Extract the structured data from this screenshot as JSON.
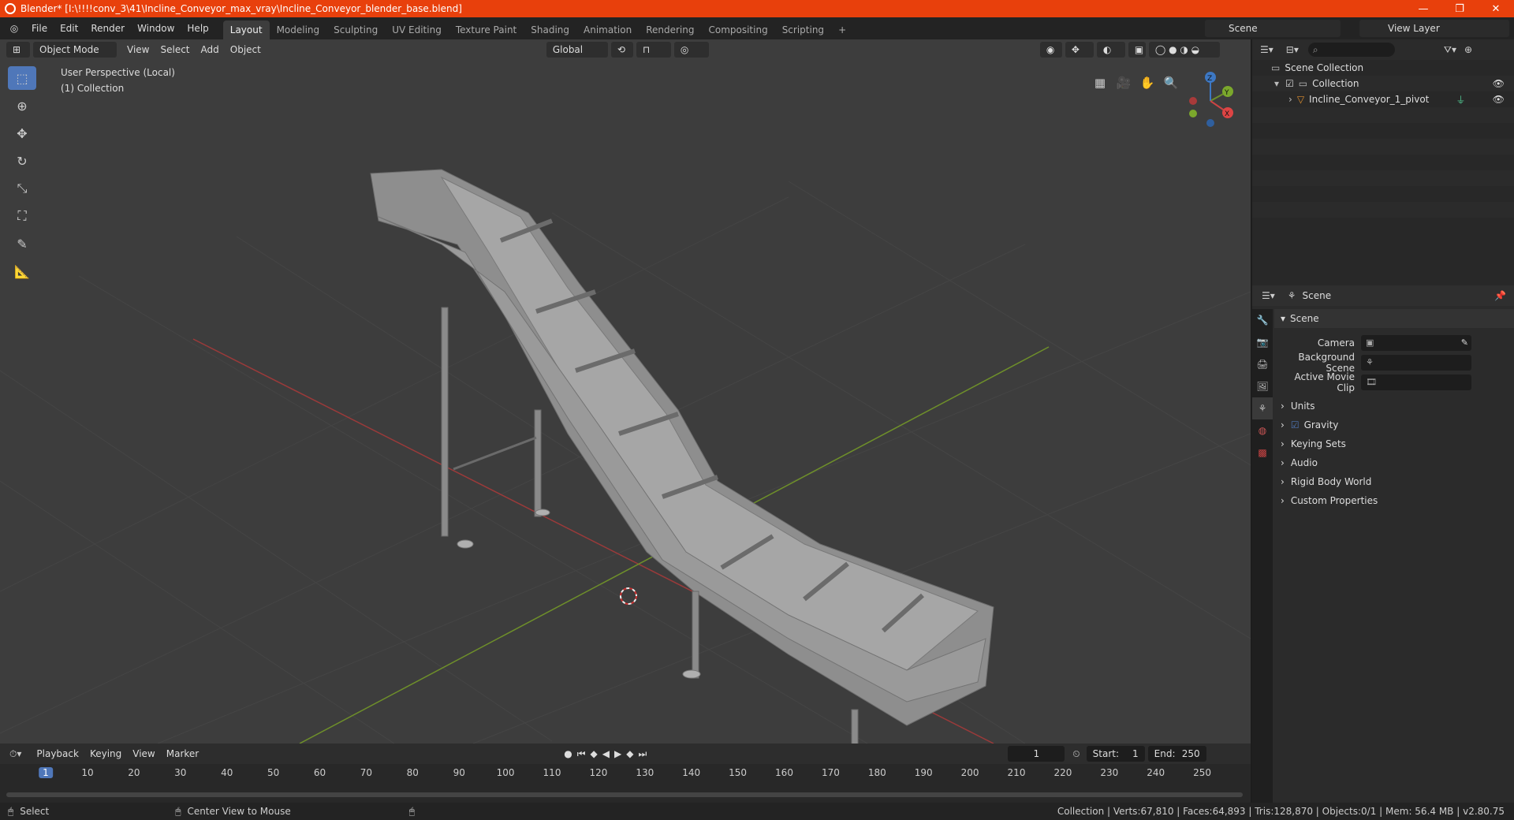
{
  "title_bar": {
    "text": "Blender* [I:\\!!!!conv_3\\41\\Incline_Conveyor_max_vray\\Incline_Conveyor_blender_base.blend]",
    "minimize": "—",
    "maximize": "❐",
    "close": "✕"
  },
  "menu": [
    "File",
    "Edit",
    "Render",
    "Window",
    "Help"
  ],
  "workspaces": [
    "Layout",
    "Modeling",
    "Sculpting",
    "UV Editing",
    "Texture Paint",
    "Shading",
    "Animation",
    "Rendering",
    "Compositing",
    "Scripting"
  ],
  "scene_name": "Scene",
  "view_layer": "View Layer",
  "viewport_header": {
    "mode": "Object Mode",
    "view": "View",
    "select": "Select",
    "add": "Add",
    "object": "Object",
    "orientation": "Global"
  },
  "viewport_overlay": {
    "perspective": "User Perspective (Local)",
    "collection": "(1) Collection"
  },
  "gizmo": {
    "x": "X",
    "y": "Y",
    "z": "Z"
  },
  "outliner": {
    "root": "Scene Collection",
    "collection": "Collection",
    "object": "Incline_Conveyor_1_pivot"
  },
  "properties": {
    "header": "Scene",
    "section": "Scene",
    "fields": [
      {
        "label": "Camera",
        "value": ""
      },
      {
        "label": "Background Scene",
        "value": ""
      },
      {
        "label": "Active Movie Clip",
        "value": ""
      }
    ],
    "subsections": [
      "Units",
      "Gravity",
      "Keying Sets",
      "Audio",
      "Rigid Body World",
      "Custom Properties"
    ]
  },
  "timeline": {
    "menu": [
      "Playback",
      "Keying",
      "View",
      "Marker"
    ],
    "current_frame": "1",
    "start_label": "Start:",
    "start": "1",
    "end_label": "End:",
    "end": "250",
    "ticks": [
      "1",
      "10",
      "20",
      "30",
      "40",
      "50",
      "60",
      "70",
      "80",
      "90",
      "100",
      "110",
      "120",
      "130",
      "140",
      "150",
      "160",
      "170",
      "180",
      "190",
      "200",
      "210",
      "220",
      "230",
      "240",
      "250"
    ]
  },
  "status": {
    "left": "Select",
    "middle": "Center View to Mouse",
    "right": "Collection | Verts:67,810 | Faces:64,893 | Tris:128,870 | Objects:0/1 | Mem: 56.4 MB | v2.80.75"
  }
}
